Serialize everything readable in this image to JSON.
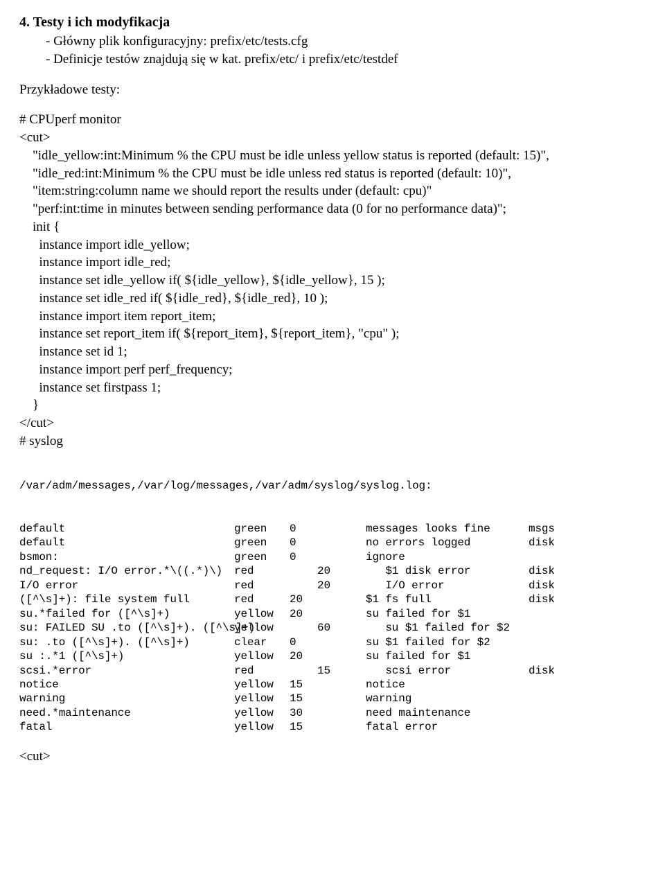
{
  "section_title": "4. Testy i ich modyfikacja",
  "bullet1": "- Główny plik konfiguracyjny: prefix/etc/tests.cfg",
  "bullet2": "- Definicje testów znajdują się w kat. prefix/etc/ i prefix/etc/testdef",
  "examples_label": "Przykładowe testy:",
  "cpu_comment": "# CPUperf monitor",
  "cut_open": "<cut>",
  "l1": "    \"idle_yellow:int:Minimum % the CPU must be idle unless yellow status is reported (default: 15)\",",
  "l2": "    \"idle_red:int:Minimum % the CPU must be idle unless red status is reported (default: 10)\",",
  "l3": "    \"item:string:column name we should report the results under (default: cpu)\"",
  "l4": "    \"perf:int:time in minutes between sending performance data (0 for no performance data)\";",
  "l5": "    init {",
  "l6": "      instance import idle_yellow;",
  "l7": "      instance import idle_red;",
  "l8": "      instance set idle_yellow if( ${idle_yellow}, ${idle_yellow}, 15 );",
  "l9": "      instance set idle_red if( ${idle_red}, ${idle_red}, 10 );",
  "l10": "      instance import item report_item;",
  "l11": "      instance set report_item if( ${report_item}, ${report_item}, \"cpu\" );",
  "l12": "      instance set id 1;",
  "l13": "      instance import perf perf_frequency;",
  "l14": "      instance set firstpass 1;",
  "l15": "    }",
  "cut_close": "</cut>",
  "syslog_comment": "# syslog",
  "syslog_header": "/var/adm/messages,/var/log/messages,/var/adm/syslog/syslog.log:",
  "rows": [
    {
      "c1": "default",
      "c2": "green",
      "c3": "0",
      "c4": "",
      "c5": "messages looks fine",
      "c6": "msgs"
    },
    {
      "c1": "default",
      "c2": "green",
      "c3": "0",
      "c4": "",
      "c5": "no errors logged",
      "c6": "disk"
    },
    {
      "c1": "bsmon:",
      "c2": "green",
      "c3": "0",
      "c4": "",
      "c5": "ignore",
      "c6": ""
    },
    {
      "c1": "nd_request: I/O error.*\\((.*)\\)",
      "c2": "red",
      "c3": "",
      "c4": "20",
      "c5": "   $1 disk error",
      "c6": "disk"
    },
    {
      "c1": "I/O error",
      "c2": "red",
      "c3": "",
      "c4": "20",
      "c5": "   I/O error",
      "c6": "disk"
    },
    {
      "c1": "([^\\s]+): file system full",
      "c2": "red",
      "c3": "20",
      "c4": "",
      "c5": "$1 fs full",
      "c6": "disk"
    },
    {
      "c1": "su.*failed for ([^\\s]+)",
      "c2": "yellow",
      "c3": "20",
      "c4": "",
      "c5": "su failed for $1",
      "c6": ""
    },
    {
      "c1": "su: FAILED SU .to ([^\\s]+). ([^\\s]+)",
      "c2": "yellow",
      "c3": "",
      "c4": "60",
      "c5": "   su $1 failed for $2",
      "c6": ""
    },
    {
      "c1": "su: .to ([^\\s]+). ([^\\s]+)",
      "c2": "clear",
      "c3": "0",
      "c4": "",
      "c5": "su $1 failed for $2",
      "c6": ""
    },
    {
      "c1": "su :.*1 ([^\\s]+)",
      "c2": "yellow",
      "c3": "20",
      "c4": "",
      "c5": "su failed for $1",
      "c6": ""
    },
    {
      "c1": "scsi.*error",
      "c2": "red",
      "c3": "",
      "c4": "15",
      "c5": "   scsi error",
      "c6": "disk"
    },
    {
      "c1": "notice",
      "c2": "yellow",
      "c3": "15",
      "c4": "",
      "c5": "notice",
      "c6": ""
    },
    {
      "c1": "warning",
      "c2": "yellow",
      "c3": "15",
      "c4": "",
      "c5": "warning",
      "c6": ""
    },
    {
      "c1": "need.*maintenance",
      "c2": "yellow",
      "c3": "30",
      "c4": "",
      "c5": "need maintenance",
      "c6": ""
    },
    {
      "c1": "fatal",
      "c2": "yellow",
      "c3": "15",
      "c4": "",
      "c5": "fatal error",
      "c6": ""
    }
  ],
  "cut_final": "   <cut>"
}
